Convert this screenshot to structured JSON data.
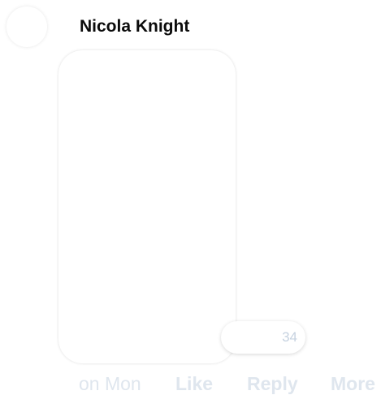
{
  "message": {
    "author": "Nicola Knight",
    "reaction_count": "34",
    "timestamp": "on Mon"
  },
  "actions": {
    "like": "Like",
    "reply": "Reply",
    "more": "More"
  }
}
